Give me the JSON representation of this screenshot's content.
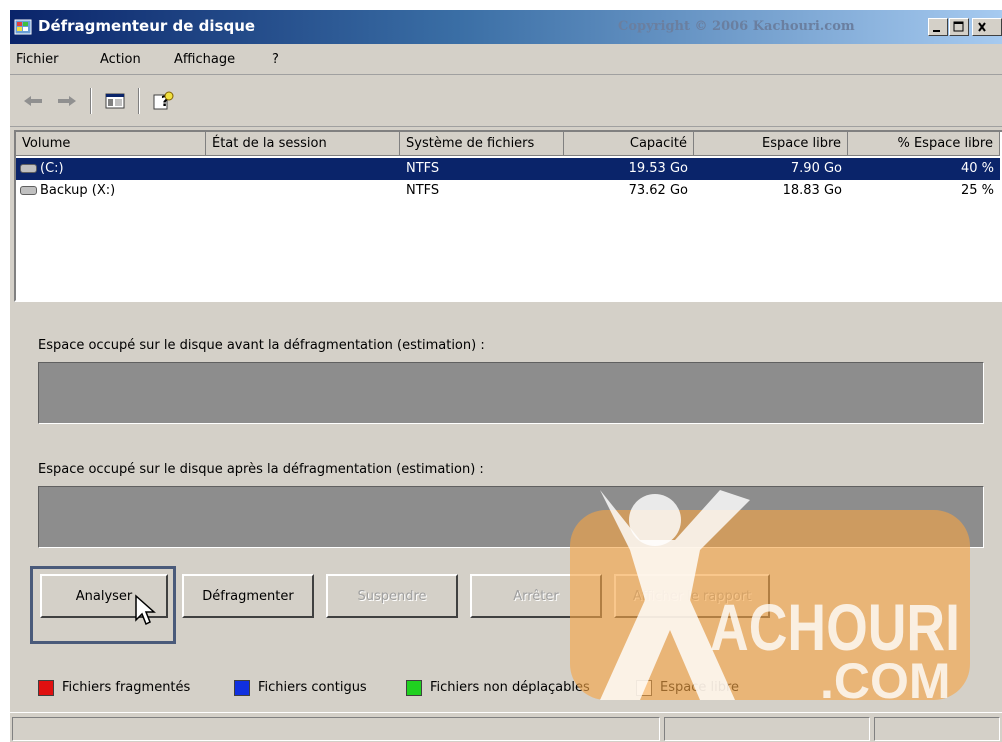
{
  "window": {
    "title": "Défragmenteur de disque",
    "copyright": "Copyright © 2006 Kachouri.com",
    "controls": {
      "minimize": "_",
      "maximize": "□",
      "close": "x"
    }
  },
  "menu": {
    "items": [
      "Fichier",
      "Action",
      "Affichage",
      "?"
    ]
  },
  "toolbar": {
    "icons": [
      "back-arrow-icon",
      "forward-arrow-icon",
      "show-hide-console-tree-icon",
      "help-icon"
    ]
  },
  "volumes": {
    "columns": [
      "Volume",
      "État de la session",
      "Système de fichiers",
      "Capacité",
      "Espace libre",
      "% Espace libre"
    ],
    "rows": [
      {
        "volume": "(C:)",
        "session": "",
        "fs": "NTFS",
        "capacity": "19.53 Go",
        "free": "7.90 Go",
        "pct": "40 %",
        "selected": true
      },
      {
        "volume": "Backup (X:)",
        "session": "",
        "fs": "NTFS",
        "capacity": "73.62 Go",
        "free": "18.83 Go",
        "pct": "25 %",
        "selected": false
      }
    ]
  },
  "analysis": {
    "before_label": "Espace occupé sur le disque avant la défragmentation (estimation) :",
    "after_label": "Espace occupé sur le disque après la défragmentation (estimation) :"
  },
  "buttons": {
    "analyze": "Analyser",
    "defrag": "Défragmenter",
    "pause": "Suspendre",
    "stop": "Arrêter",
    "report": "Afficher le rapport"
  },
  "legend": {
    "items": [
      {
        "label": "Fichiers fragmentés",
        "color": "#e01010"
      },
      {
        "label": "Fichiers contigus",
        "color": "#1030e0"
      },
      {
        "label": "Fichiers non déplaçables",
        "color": "#20d020"
      },
      {
        "label": "Espace libre",
        "color": "#ffffff"
      }
    ]
  },
  "watermark": {
    "brand": "KACHOURI",
    "suffix": ".COM",
    "color": "#f0a050"
  },
  "colors": {
    "selection": "#0a246a",
    "chrome": "#d4d0c8",
    "bar": "#8d8d8d"
  }
}
